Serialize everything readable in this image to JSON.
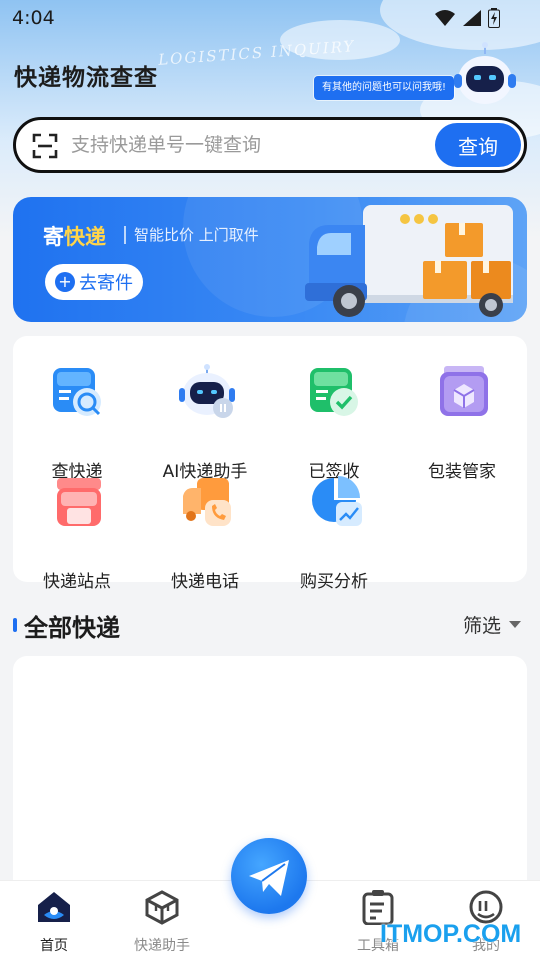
{
  "status_bar": {
    "time": "4:04"
  },
  "header": {
    "title": "快递物流查查",
    "watermark_text": "LOGISTICS INQUIRY",
    "robot_bubble": "有其他的问题也可以问我哦!"
  },
  "search": {
    "placeholder": "支持快递单号一键查询",
    "button_label": "查询"
  },
  "banner": {
    "title_prefix": "寄",
    "title_highlight": "快递",
    "subtitle": "智能比价 上门取件",
    "button_label": "去寄件",
    "accent_color": "#1e6ff1",
    "highlight_color": "#ffd54a"
  },
  "features": [
    {
      "label": "查快递",
      "icon": "package-search-icon"
    },
    {
      "label": "AI快递助手",
      "icon": "robot-icon"
    },
    {
      "label": "已签收",
      "icon": "checkmark-icon"
    },
    {
      "label": "包装管家",
      "icon": "box-stack-icon"
    },
    {
      "label": "快递站点",
      "icon": "shop-icon"
    },
    {
      "label": "快递电话",
      "icon": "phone-truck-icon"
    },
    {
      "label": "购买分析",
      "icon": "pie-chart-icon"
    }
  ],
  "section": {
    "title": "全部快递",
    "filter_label": "筛选"
  },
  "bottom_nav": [
    {
      "label": "首页",
      "icon": "home-icon",
      "active": true
    },
    {
      "label": "快递助手",
      "icon": "cube-icon",
      "active": false
    },
    {
      "label": "工具箱",
      "icon": "clipboard-icon",
      "active": false
    },
    {
      "label": "我的",
      "icon": "profile-icon",
      "active": false
    }
  ],
  "footer_watermark": "ITMOP.COM"
}
